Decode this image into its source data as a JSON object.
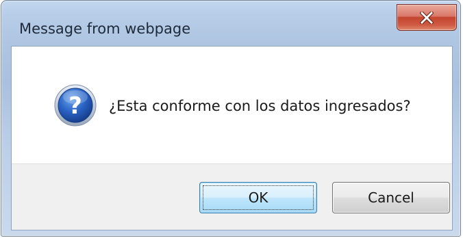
{
  "dialog": {
    "title": "Message from webpage",
    "message": "¿Esta conforme con los datos ingresados?",
    "icon": "question-icon",
    "close_icon": "close-icon"
  },
  "buttons": {
    "ok_label": "OK",
    "cancel_label": "Cancel"
  },
  "colors": {
    "close_button": "#c4452f",
    "frame": "#afc6e2",
    "question_icon": "#1f5fb8"
  }
}
